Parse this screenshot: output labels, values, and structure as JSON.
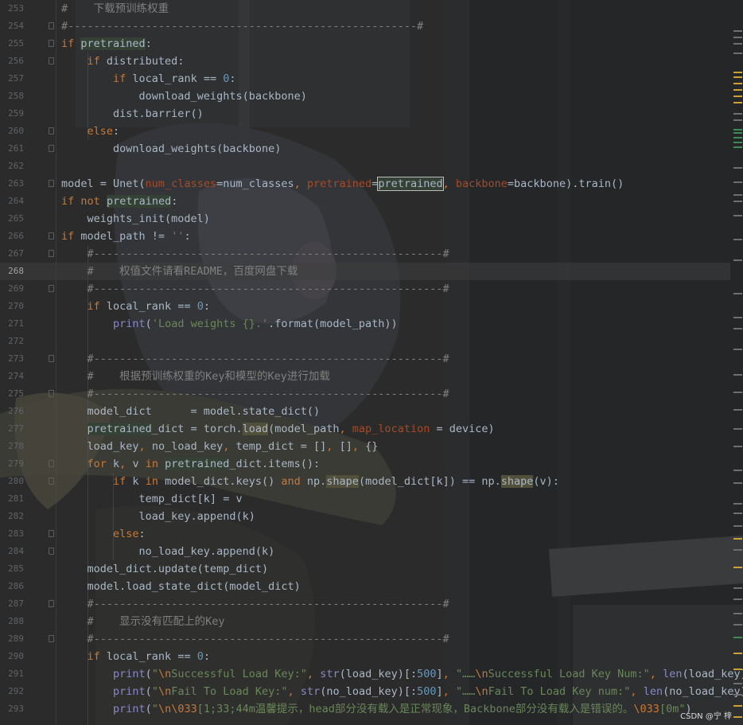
{
  "colors": {
    "background": "#2b2b2b",
    "keyword": "#cc7832",
    "comment": "#808080",
    "string": "#6a8759",
    "number": "#6897bb",
    "param": "#aa4926",
    "builtin": "#8888c6",
    "text": "#a9b7c6",
    "highlight": "#344134"
  },
  "editor": {
    "current_line": "268",
    "lines": [
      {
        "n": "253",
        "t": "#    下载预训练权重"
      },
      {
        "n": "254",
        "t": "#------------------------------------------------------#"
      },
      {
        "n": "255",
        "t": "if pretrained:"
      },
      {
        "n": "256",
        "t": "    if distributed:"
      },
      {
        "n": "257",
        "t": "        if local_rank == 0:"
      },
      {
        "n": "258",
        "t": "            download_weights(backbone)"
      },
      {
        "n": "259",
        "t": "        dist.barrier()"
      },
      {
        "n": "260",
        "t": "    else:"
      },
      {
        "n": "261",
        "t": "        download_weights(backbone)"
      },
      {
        "n": "262",
        "t": ""
      },
      {
        "n": "263",
        "t": "model = Unet(num_classes=num_classes, pretrained=pretrained, backbone=backbone).train()"
      },
      {
        "n": "264",
        "t": "if not pretrained:"
      },
      {
        "n": "265",
        "t": "    weights_init(model)"
      },
      {
        "n": "266",
        "t": "if model_path != '':"
      },
      {
        "n": "267",
        "t": "    #------------------------------------------------------#"
      },
      {
        "n": "268",
        "t": "    #    权值文件请看README，百度网盘下载"
      },
      {
        "n": "269",
        "t": "    #------------------------------------------------------#"
      },
      {
        "n": "270",
        "t": "    if local_rank == 0:"
      },
      {
        "n": "271",
        "t": "        print('Load weights {}.'.format(model_path))"
      },
      {
        "n": "272",
        "t": ""
      },
      {
        "n": "273",
        "t": "    #------------------------------------------------------#"
      },
      {
        "n": "274",
        "t": "    #    根据预训练权重的Key和模型的Key进行加载"
      },
      {
        "n": "275",
        "t": "    #------------------------------------------------------#"
      },
      {
        "n": "276",
        "t": "    model_dict      = model.state_dict()"
      },
      {
        "n": "277",
        "t": "    pretrained_dict = torch.load(model_path, map_location = device)"
      },
      {
        "n": "278",
        "t": "    load_key, no_load_key, temp_dict = [], [], {}"
      },
      {
        "n": "279",
        "t": "    for k, v in pretrained_dict.items():"
      },
      {
        "n": "280",
        "t": "        if k in model_dict.keys() and np.shape(model_dict[k]) == np.shape(v):"
      },
      {
        "n": "281",
        "t": "            temp_dict[k] = v"
      },
      {
        "n": "282",
        "t": "            load_key.append(k)"
      },
      {
        "n": "283",
        "t": "        else:"
      },
      {
        "n": "284",
        "t": "            no_load_key.append(k)"
      },
      {
        "n": "285",
        "t": "    model_dict.update(temp_dict)"
      },
      {
        "n": "286",
        "t": "    model.load_state_dict(model_dict)"
      },
      {
        "n": "287",
        "t": "    #------------------------------------------------------#"
      },
      {
        "n": "288",
        "t": "    #    显示没有匹配上的Key"
      },
      {
        "n": "289",
        "t": "    #------------------------------------------------------#"
      },
      {
        "n": "290",
        "t": "    if local_rank == 0:"
      },
      {
        "n": "291",
        "t": "        print(\"\\nSuccessful Load Key:\", str(load_key)[:500], \"……\\nSuccessful Load Key Num:\", len(load_key))"
      },
      {
        "n": "292",
        "t": "        print(\"\\nFail To Load Key:\", str(no_load_key)[:500], \"……\\nFail To Load Key num:\", len(no_load_key))"
      },
      {
        "n": "293",
        "t": "        print(\"\\n\\033[1;33;44m温馨提示，head部分没有载入是正常现象，Backbone部分没有载入是错误的。\\033[0m\")"
      }
    ]
  },
  "watermark": "CSDN @宁 梓"
}
